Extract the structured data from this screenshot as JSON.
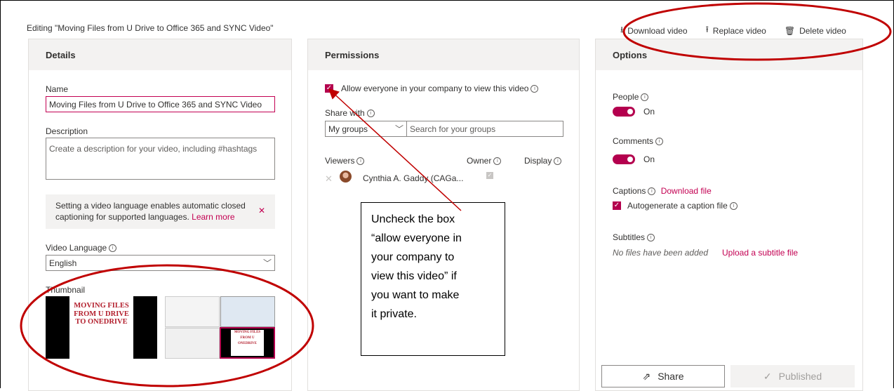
{
  "header": {
    "editing_title": "Editing \"Moving Files from U Drive to Office 365 and SYNC Video\"",
    "download_label": "Download video",
    "replace_label": "Replace video",
    "delete_label": "Delete video"
  },
  "details": {
    "heading": "Details",
    "name_label": "Name",
    "name_value": "Moving Files from U Drive to Office 365 and SYNC Video",
    "description_label": "Description",
    "description_placeholder": "Create a description for your video, including #hashtags",
    "notice_text": "Setting a video language enables automatic closed captioning for supported languages.",
    "notice_link": "Learn more",
    "language_label": "Video Language",
    "language_value": "English",
    "thumbnail_label": "Thumbnail",
    "thumb_title_text": "MOVING FILES FROM U DRIVE TO ONEDRIVE",
    "thumb_small_text": "MOVING FILES FROM U ONEDRIVE"
  },
  "permissions": {
    "heading": "Permissions",
    "allow_label": "Allow everyone in your company to view this video",
    "allow_checked": true,
    "share_with_label": "Share with",
    "share_select_value": "My groups",
    "share_search_placeholder": "Search for your groups",
    "viewers_label": "Viewers",
    "owner_label": "Owner",
    "display_label": "Display",
    "viewer_name": "Cynthia A. Gaddy (CAGa..."
  },
  "options": {
    "heading": "Options",
    "people_label": "People",
    "people_state": "On",
    "comments_label": "Comments",
    "comments_state": "On",
    "captions_label": "Captions",
    "captions_download": "Download file",
    "autogen_label": "Autogenerate a caption file",
    "subtitles_label": "Subtitles",
    "no_files_text": "No files have been added",
    "upload_subtitle": "Upload a subtitle file",
    "share_button": "Share",
    "published_button": "Published"
  },
  "annotation": {
    "callout_text": "Uncheck the box\n“allow everyone in\nyour company to\nview this video” if\nyou want to make\nit private."
  },
  "colors": {
    "accent": "#b4004e",
    "annotation": "#c00000",
    "panel_header": "#f3f2f1"
  }
}
